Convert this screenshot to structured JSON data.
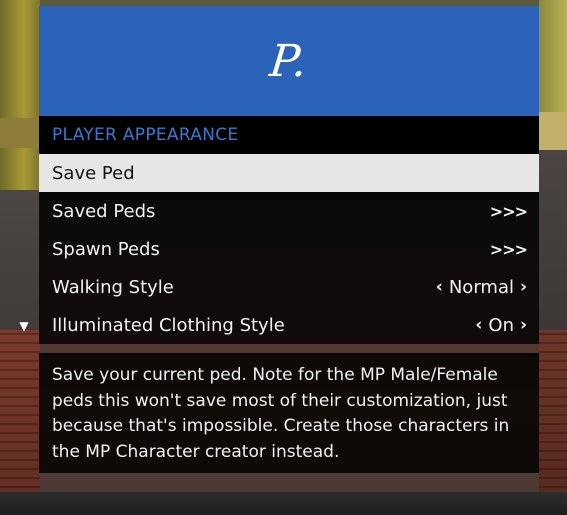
{
  "menu": {
    "banner_logo": "P.",
    "subtitle": "PLAYER APPEARANCE",
    "items": [
      {
        "label": "Save Ped",
        "value": "",
        "selected": true
      },
      {
        "label": "Saved Peds",
        "value": ">>>",
        "type": "submenu"
      },
      {
        "label": "Spawn Peds",
        "value": ">>>",
        "type": "submenu"
      },
      {
        "label": "Walking Style",
        "value": "Normal",
        "type": "list",
        "left_arrow": "‹",
        "right_arrow": "›"
      },
      {
        "label": "Illuminated Clothing Style",
        "value": "On",
        "type": "list",
        "left_arrow": "‹",
        "right_arrow": "›"
      }
    ],
    "scroll_indicator_icon": "scroll-down-icon",
    "description": "Save your current ped. Note for the MP Male/Female peds this won't save most of their customization, just because that's impossible. Create those characters in the MP Character creator instead."
  },
  "colors": {
    "banner": "#2b63b8",
    "subtitle_text": "#3a78d0",
    "selected_row": "#e6e6e6"
  }
}
